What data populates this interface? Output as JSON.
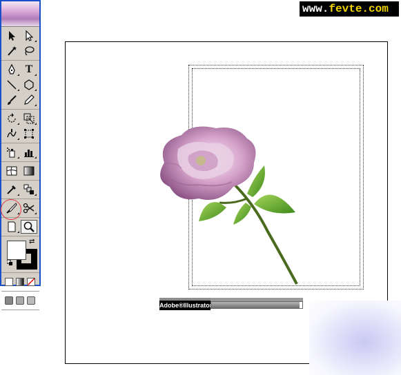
{
  "watermark": {
    "www": "www.",
    "domain": "fevte.com"
  },
  "toolbox": {
    "tools": [
      {
        "name": "selection-tool",
        "icon": "arrow-icon"
      },
      {
        "name": "direct-selection-tool",
        "icon": "hollow-arrow-icon"
      },
      {
        "name": "magic-wand-tool",
        "icon": "magic-wand-icon"
      },
      {
        "name": "lasso-tool",
        "icon": "lasso-icon"
      },
      {
        "name": "pen-tool",
        "icon": "pen-icon"
      },
      {
        "name": "type-tool",
        "icon": "type-icon",
        "glyph": "T"
      },
      {
        "name": "line-tool",
        "icon": "line-icon"
      },
      {
        "name": "polygon-tool",
        "icon": "polygon-icon"
      },
      {
        "name": "paintbrush-tool",
        "icon": "brush-icon"
      },
      {
        "name": "pencil-tool",
        "icon": "pencil-icon"
      },
      {
        "name": "rotate-tool",
        "icon": "rotate-icon"
      },
      {
        "name": "scale-tool",
        "icon": "scale-icon"
      },
      {
        "name": "warp-tool",
        "icon": "warp-icon"
      },
      {
        "name": "free-transform-tool",
        "icon": "free-transform-icon"
      },
      {
        "name": "symbol-sprayer-tool",
        "icon": "sprayer-icon"
      },
      {
        "name": "graph-tool",
        "icon": "bar-graph-icon"
      },
      {
        "name": "mesh-tool",
        "icon": "mesh-icon"
      },
      {
        "name": "gradient-tool",
        "icon": "gradient-icon"
      },
      {
        "name": "eyedropper-tool",
        "icon": "eyedropper-icon"
      },
      {
        "name": "blend-tool",
        "icon": "blend-icon"
      },
      {
        "name": "slice-tool",
        "icon": "knife-icon"
      },
      {
        "name": "scissors-tool",
        "icon": "scissors-icon"
      },
      {
        "name": "page-tool",
        "icon": "page-icon"
      },
      {
        "name": "zoom-tool",
        "icon": "magnifier-icon"
      }
    ],
    "highlighted_tool": "page-tool",
    "fill_color": "#ffffff",
    "stroke_color": "#000000"
  },
  "splash": {
    "logo_text": "Adobe®Illustrator®",
    "progress": 0.97
  },
  "colors": {
    "toolbox_border": "#1a4fcc",
    "highlight_circle": "#e23b3b",
    "watermark_domain": "#f2d400"
  }
}
